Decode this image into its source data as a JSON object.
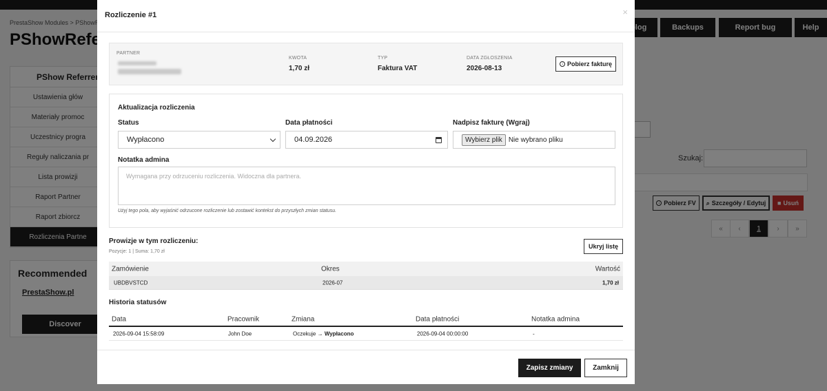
{
  "background": {
    "breadcrumb": "PrestaShow Modules  >  PShowR",
    "page_title": "PShowRefer",
    "top_buttons": [
      "elog",
      "Backups",
      "Report bug",
      "Help"
    ],
    "sidebar": {
      "title": "PShow Referrer",
      "items": [
        "Ustawienia głów",
        "Materiały promoc",
        "Uczestnicy progra",
        "Reguły naliczania pr",
        "Lista prowizji",
        "Raport Partner",
        "Raport zbiorcz",
        "Rozliczenia Partne"
      ],
      "active_index": 7
    },
    "recommended": {
      "title": "Recommended",
      "link": "PrestaShow.pl",
      "button": "Discover"
    },
    "search_label": "Szukaj:",
    "row_actions": [
      "Pobierz FV",
      "Szczegóły / Edytuj",
      "Usuń"
    ],
    "pager": [
      "«",
      "‹",
      "1",
      "›",
      "»"
    ],
    "colors": {
      "danger": "#c9302c",
      "dark": "#1c1c1c"
    }
  },
  "modal": {
    "title": "Rozliczenie #1",
    "close_icon": "×",
    "summary": {
      "partner_label": "PARTNER",
      "kwota_label": "KWOTA",
      "kwota_value": "1,70 zł",
      "typ_label": "TYP",
      "typ_value": "Faktura VAT",
      "date_label": "DATA ZGŁOSZENIA",
      "date_value": "2026-08-13",
      "download_button": "Pobierz fakturę"
    },
    "update": {
      "title": "Aktualizacja rozliczenia",
      "status_label": "Status",
      "status_value": "Wypłacono",
      "payment_date_label": "Data płatności",
      "payment_date_value": "04.09.2026",
      "invoice_label": "Nadpisz fakturę (Wgraj)",
      "file_button": "Wybierz plik",
      "file_status": "Nie wybrano pliku",
      "note_label": "Notatka admina",
      "note_placeholder": "Wymagana przy odrzuceniu rozliczenia. Widoczna dla partnera.",
      "note_help": "Użyj tego pola, aby wyjaśnić odrzucone rozliczenie lub zostawić kontekst do przyszłych zmian statusu."
    },
    "commissions": {
      "title": "Prowizje w tym rozliczeniu:",
      "subtitle": "Pozycje: 1 | Suma: 1,70 zł",
      "hide_button": "Ukryj listę",
      "headers": [
        "Zamówienie",
        "Okres",
        "Wartość"
      ],
      "rows": [
        {
          "order": "UBDBVSTCD",
          "period": "2026-07",
          "value": "1,70 zł"
        }
      ]
    },
    "history": {
      "title": "Historia statusów",
      "headers": [
        "Data",
        "Pracownik",
        "Zmiana",
        "Data płatności",
        "Notatka admina"
      ],
      "rows": [
        {
          "date": "2026-09-04 15:58:09",
          "employee": "John Doe",
          "change_from": "Oczekuje",
          "arrow": "→",
          "change_to": "Wypłacono",
          "payment_date": "2026-09-04 00:00:00",
          "note": "-"
        }
      ]
    },
    "footer": {
      "save_button": "Zapisz zmiany",
      "close_button": "Zamknij"
    }
  }
}
